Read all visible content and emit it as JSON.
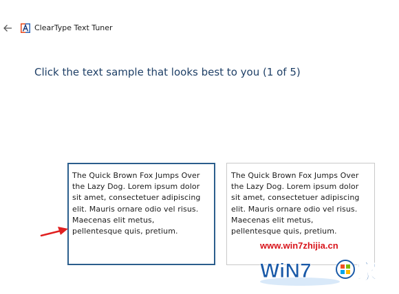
{
  "app": {
    "title": "ClearType Text Tuner"
  },
  "instruction": "Click the text sample that looks best to you (1 of 5)",
  "samples": [
    {
      "selected": true,
      "text": "The Quick Brown Fox Jumps Over\nthe Lazy Dog. Lorem ipsum dolor\nsit amet, consectetuer adipiscing\nelit. Mauris ornare odio vel risus.\nMaecenas elit metus,\npellentesque quis, pretium."
    },
    {
      "selected": false,
      "text": "The Quick Brown Fox Jumps Over\nthe Lazy Dog. Lorem ipsum dolor\nsit amet, consectetuer adipiscing\nelit. Mauris ornare odio vel risus.\nMaecenas elit metus,\npellentesque quis, pretium."
    }
  ],
  "watermark": {
    "url": "www.win7zhijia.cn",
    "logo_text": "WiN7家"
  },
  "icons": {
    "back": "arrow-left-icon",
    "app": "cleartype-icon",
    "annotation": "red-arrow-icon"
  },
  "colors": {
    "accent": "#2a5d8c",
    "instruction": "#1e3f66",
    "annotation": "#e02020",
    "watermark_red": "#d8141b",
    "watermark_blue": "#1a5aa8"
  }
}
